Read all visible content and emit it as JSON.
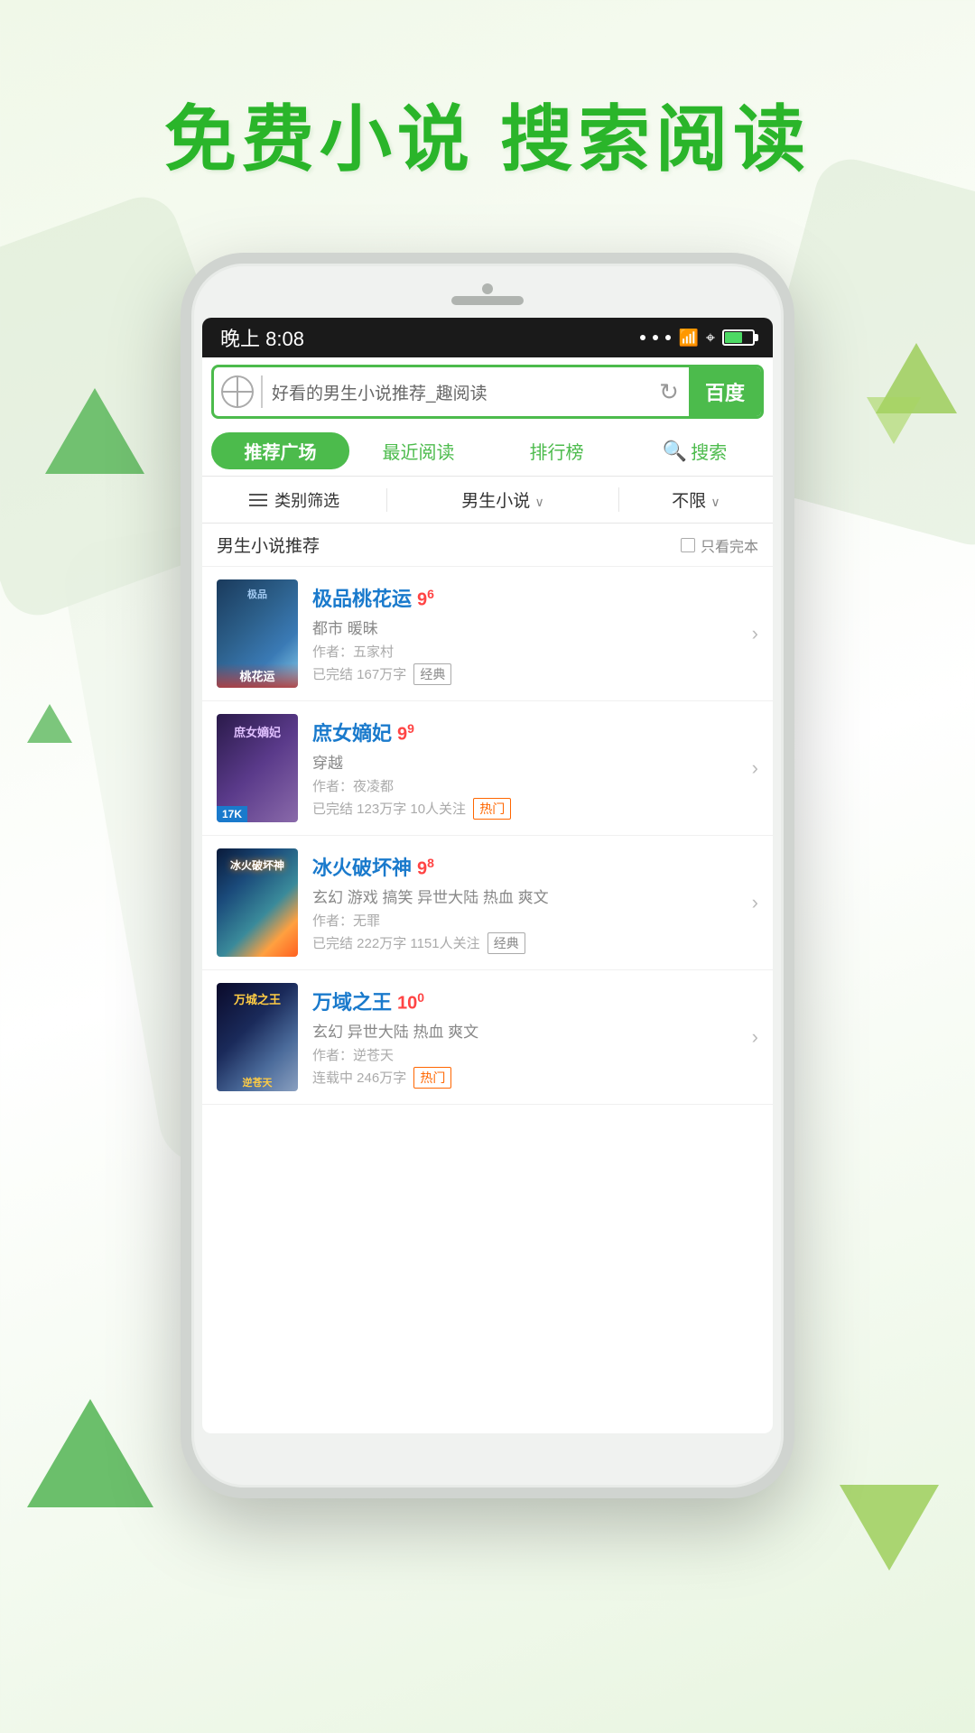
{
  "header": {
    "title": "免费小说  搜索阅读"
  },
  "background": {
    "accent_green": "#2ab52a",
    "light_green": "#8dc63f"
  },
  "status_bar": {
    "time": "晚上 8:08",
    "signal": "...",
    "wifi": "WiFi",
    "battery": "60%"
  },
  "search_bar": {
    "query": "好看的男生小说推荐_趣阅读",
    "baidu_label": "百度"
  },
  "tabs": [
    {
      "label": "推荐广场",
      "active": true
    },
    {
      "label": "最近阅读",
      "active": false
    },
    {
      "label": "排行榜",
      "active": false
    },
    {
      "label": "搜索",
      "active": false,
      "has_icon": true
    }
  ],
  "filter": {
    "category_label": "类别筛选",
    "genre_label": "男生小说",
    "limit_label": "不限"
  },
  "section": {
    "title": "男生小说推荐",
    "only_complete": "只看完本"
  },
  "books": [
    {
      "id": 1,
      "title": "极品桃花运",
      "rating": "9",
      "rating_sup": "6",
      "tags": "都市 暖昧",
      "author": "作者：五家村",
      "stats": "已完结 167万字",
      "badge": "经典",
      "badge_type": "classic",
      "cover_label": "极品\n桃花运"
    },
    {
      "id": 2,
      "title": "庶女嫡妃",
      "rating": "9",
      "rating_sup": "9",
      "tags": "穿越",
      "author": "作者：夜凌都",
      "stats": "已完结 123万字 10人关注",
      "badge": "热门",
      "badge_type": "hot",
      "cover_label": "17K"
    },
    {
      "id": 3,
      "title": "冰火破坏神",
      "rating": "9",
      "rating_sup": "8",
      "tags": "玄幻 游戏 搞笑 异世大陆 热血 爽文",
      "author": "作者：无罪",
      "stats": "已完结 222万字 1151人关注",
      "badge": "经典",
      "badge_type": "classic",
      "cover_label": ""
    },
    {
      "id": 4,
      "title": "万域之王",
      "rating": "10",
      "rating_sup": "0",
      "tags": "玄幻 异世大陆 热血 爽文",
      "author": "作者：逆苍天",
      "stats": "连载中 246万字",
      "badge": "热门",
      "badge_type": "hot",
      "cover_label": "万城之王"
    }
  ]
}
